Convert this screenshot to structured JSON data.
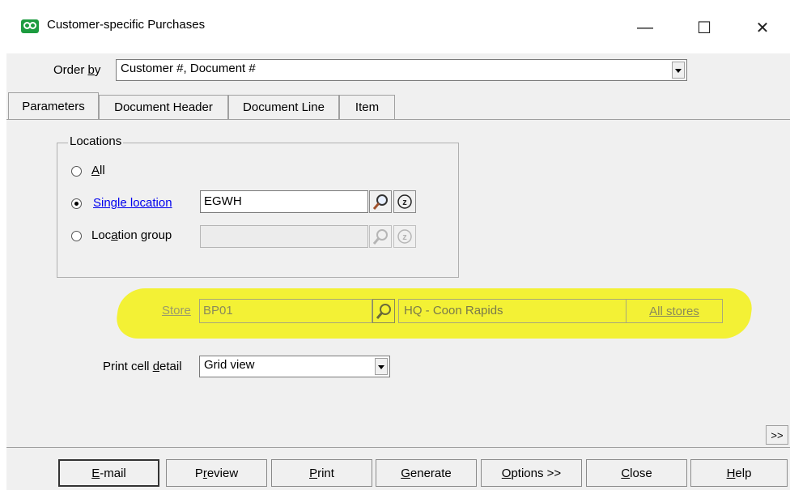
{
  "window": {
    "title": "Customer-specific Purchases",
    "minimize_glyph": "—",
    "maximize_glyph": "☐",
    "close_glyph": "✕"
  },
  "order_by": {
    "label_pre": "Order ",
    "label_key": "b",
    "label_post": "y",
    "value": "Customer #, Document #"
  },
  "tabs": [
    "Parameters",
    "Document Header",
    "Document Line",
    "Item"
  ],
  "locations": {
    "title": "Locations",
    "all_label_key": "A",
    "all_label_post": "ll",
    "single_label": "Single location",
    "single_value": "EGWH",
    "group_label_pre": "Loc",
    "group_label_key": "a",
    "group_label_post": "tion group",
    "group_value": "",
    "selected": "single"
  },
  "store": {
    "label": "Store",
    "value": "BP01",
    "description": "HQ - Coon Rapids",
    "all_stores_label": "All stores"
  },
  "print_cell_detail": {
    "label_pre": "Print cell ",
    "label_key": "d",
    "label_post": "etail",
    "value": "Grid view"
  },
  "expand_glyph": ">>",
  "buttons": {
    "email_key": "E",
    "email_post": "-mail",
    "preview_pre": "P",
    "preview_key": "r",
    "preview_post": "eview",
    "print_key": "P",
    "print_post": "rint",
    "generate_key": "G",
    "generate_post": "enerate",
    "options_key": "O",
    "options_post": "ptions >>",
    "close_key": "C",
    "close_post": "lose",
    "help_key": "H",
    "help_post": "elp"
  },
  "colors": {
    "highlight": "#f2f02a",
    "link": "#0000ee",
    "app_icon": "#1c9b3f"
  }
}
